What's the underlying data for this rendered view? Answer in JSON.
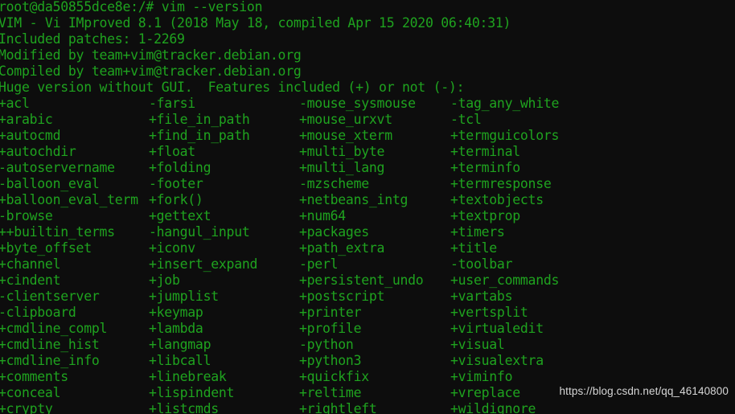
{
  "terminal": {
    "background_color": "#0d0d0d",
    "text_color": "#1fa31f",
    "prompt_line": "root@da50855dce8e:/# vim --version",
    "header_lines": [
      "VIM - Vi IMproved 8.1 (2018 May 18, compiled Apr 15 2020 06:40:31)",
      "Included patches: 1-2269",
      "Modified by team+vim@tracker.debian.org",
      "Compiled by team+vim@tracker.debian.org",
      "Huge version without GUI.  Features included (+) or not (-):"
    ],
    "feature_rows": [
      [
        "+acl",
        "-farsi",
        "-mouse_sysmouse",
        "-tag_any_white"
      ],
      [
        "+arabic",
        "+file_in_path",
        "+mouse_urxvt",
        "-tcl"
      ],
      [
        "+autocmd",
        "+find_in_path",
        "+mouse_xterm",
        "+termguicolors"
      ],
      [
        "+autochdir",
        "+float",
        "+multi_byte",
        "+terminal"
      ],
      [
        "-autoservername",
        "+folding",
        "+multi_lang",
        "+terminfo"
      ],
      [
        "-balloon_eval",
        "-footer",
        "-mzscheme",
        "+termresponse"
      ],
      [
        "+balloon_eval_term",
        "+fork()",
        "+netbeans_intg",
        "+textobjects"
      ],
      [
        "-browse",
        "+gettext",
        "+num64",
        "+textprop"
      ],
      [
        "++builtin_terms",
        "-hangul_input",
        "+packages",
        "+timers"
      ],
      [
        "+byte_offset",
        "+iconv",
        "+path_extra",
        "+title"
      ],
      [
        "+channel",
        "+insert_expand",
        "-perl",
        "-toolbar"
      ],
      [
        "+cindent",
        "+job",
        "+persistent_undo",
        "+user_commands"
      ],
      [
        "-clientserver",
        "+jumplist",
        "+postscript",
        "+vartabs"
      ],
      [
        "-clipboard",
        "+keymap",
        "+printer",
        "+vertsplit"
      ],
      [
        "+cmdline_compl",
        "+lambda",
        "+profile",
        "+virtualedit"
      ],
      [
        "+cmdline_hist",
        "+langmap",
        "-python",
        "+visual"
      ],
      [
        "+cmdline_info",
        "+libcall",
        "+python3",
        "+visualextra"
      ],
      [
        "+comments",
        "+linebreak",
        "+quickfix",
        "+viminfo"
      ],
      [
        "+conceal",
        "+lispindent",
        "+reltime",
        "+vreplace"
      ],
      [
        "+crypty",
        "+listcmds",
        "+rightleft",
        "+wildignore"
      ]
    ]
  },
  "watermark": {
    "text": "https://blog.csdn.net/qq_46140800",
    "color": "#d6d6d6"
  }
}
